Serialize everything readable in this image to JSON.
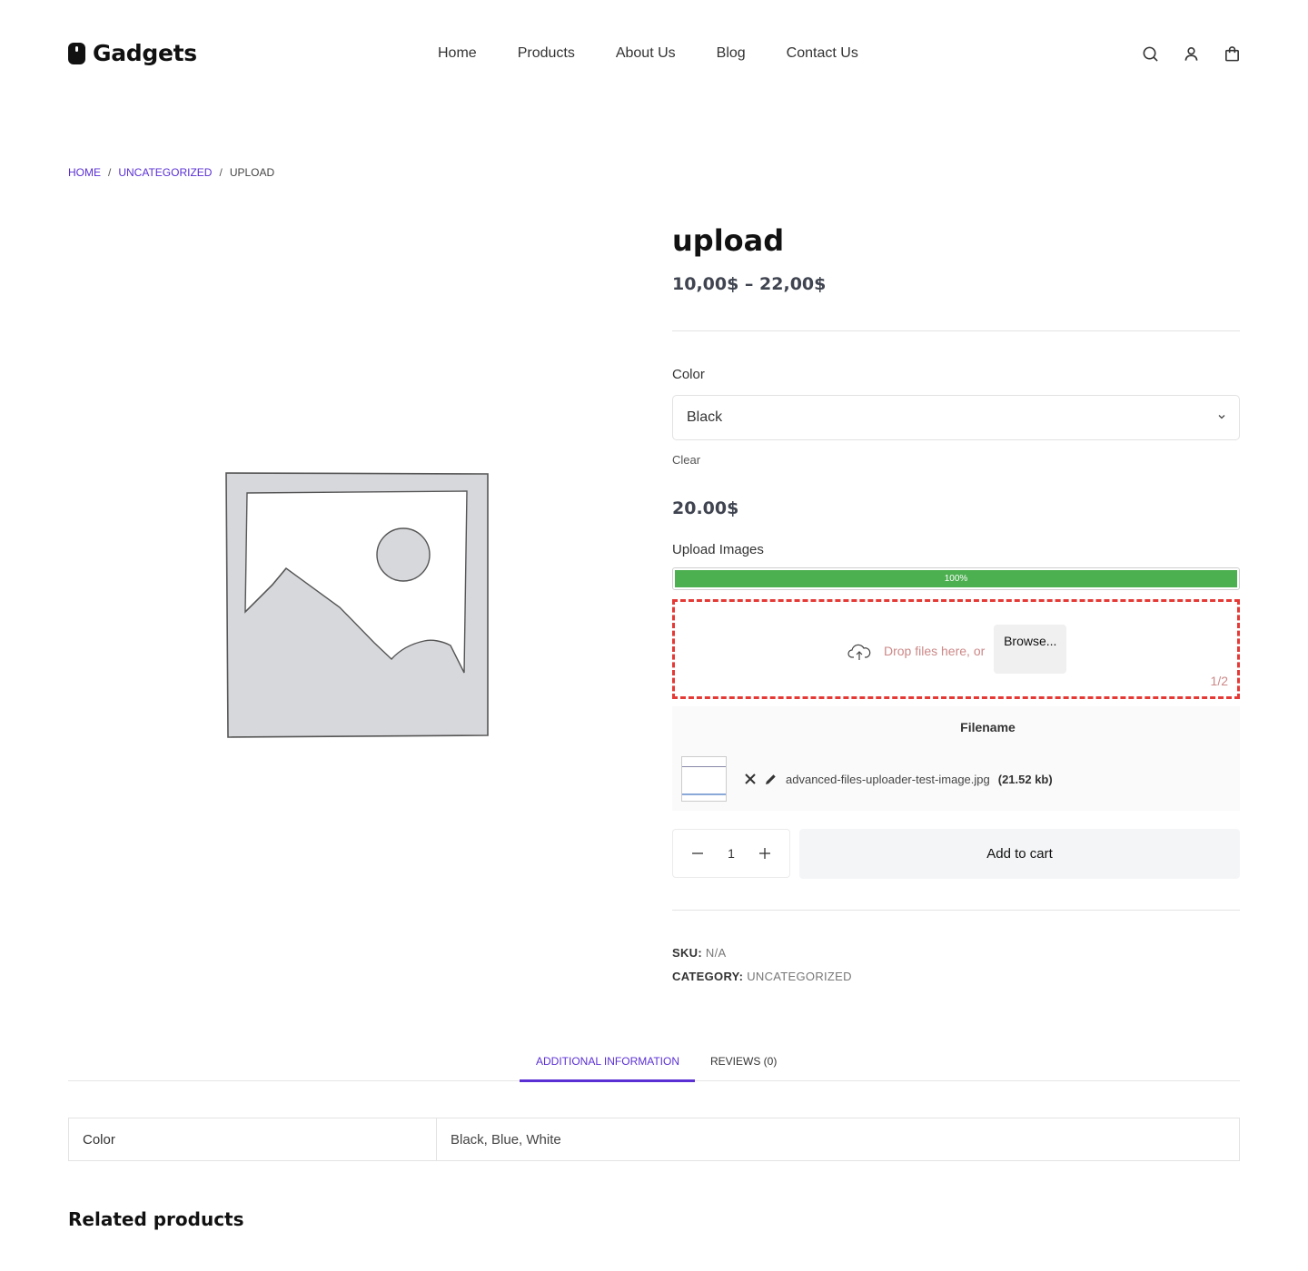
{
  "brand": {
    "name": "Gadgets"
  },
  "nav": {
    "items": [
      {
        "label": "Home"
      },
      {
        "label": "Products"
      },
      {
        "label": "About Us"
      },
      {
        "label": "Blog"
      },
      {
        "label": "Contact Us"
      }
    ]
  },
  "header_icons": [
    "search-icon",
    "account-icon",
    "cart-icon"
  ],
  "breadcrumb": {
    "home": "HOME",
    "separator": "/",
    "category": "UNCATEGORIZED",
    "current": "UPLOAD"
  },
  "product": {
    "title": "upload",
    "price_range": "10,00$ – 22,00$",
    "color_label": "Color",
    "color_selected": "Black",
    "clear_label": "Clear",
    "variation_price": "20.00$",
    "upload_label": "Upload Images",
    "upload_progress": 1.0,
    "upload_progress_label": "100%",
    "dropzone_text": "Drop files here, or",
    "browse_label": "Browse...",
    "file_count": "1/2",
    "file_table_header": "Filename",
    "files": [
      {
        "name": "advanced-files-uploader-test-image.jpg",
        "size": "(21.52 kb)"
      }
    ],
    "quantity": "1",
    "add_to_cart_label": "Add to cart",
    "sku_label": "SKU:",
    "sku_value": "N/A",
    "category_label": "CATEGORY:",
    "category_value": "UNCATEGORIZED"
  },
  "tabs": {
    "items": [
      {
        "label": "ADDITIONAL INFORMATION",
        "active": true
      },
      {
        "label": "REVIEWS (0)",
        "active": false
      }
    ]
  },
  "attributes": [
    {
      "name": "Color",
      "value": "Black, Blue, White"
    }
  ],
  "related_title": "Related products",
  "colors": {
    "accent": "#5a2fd4",
    "progress": "#4caf50",
    "dropzone_border": "#e53935"
  }
}
